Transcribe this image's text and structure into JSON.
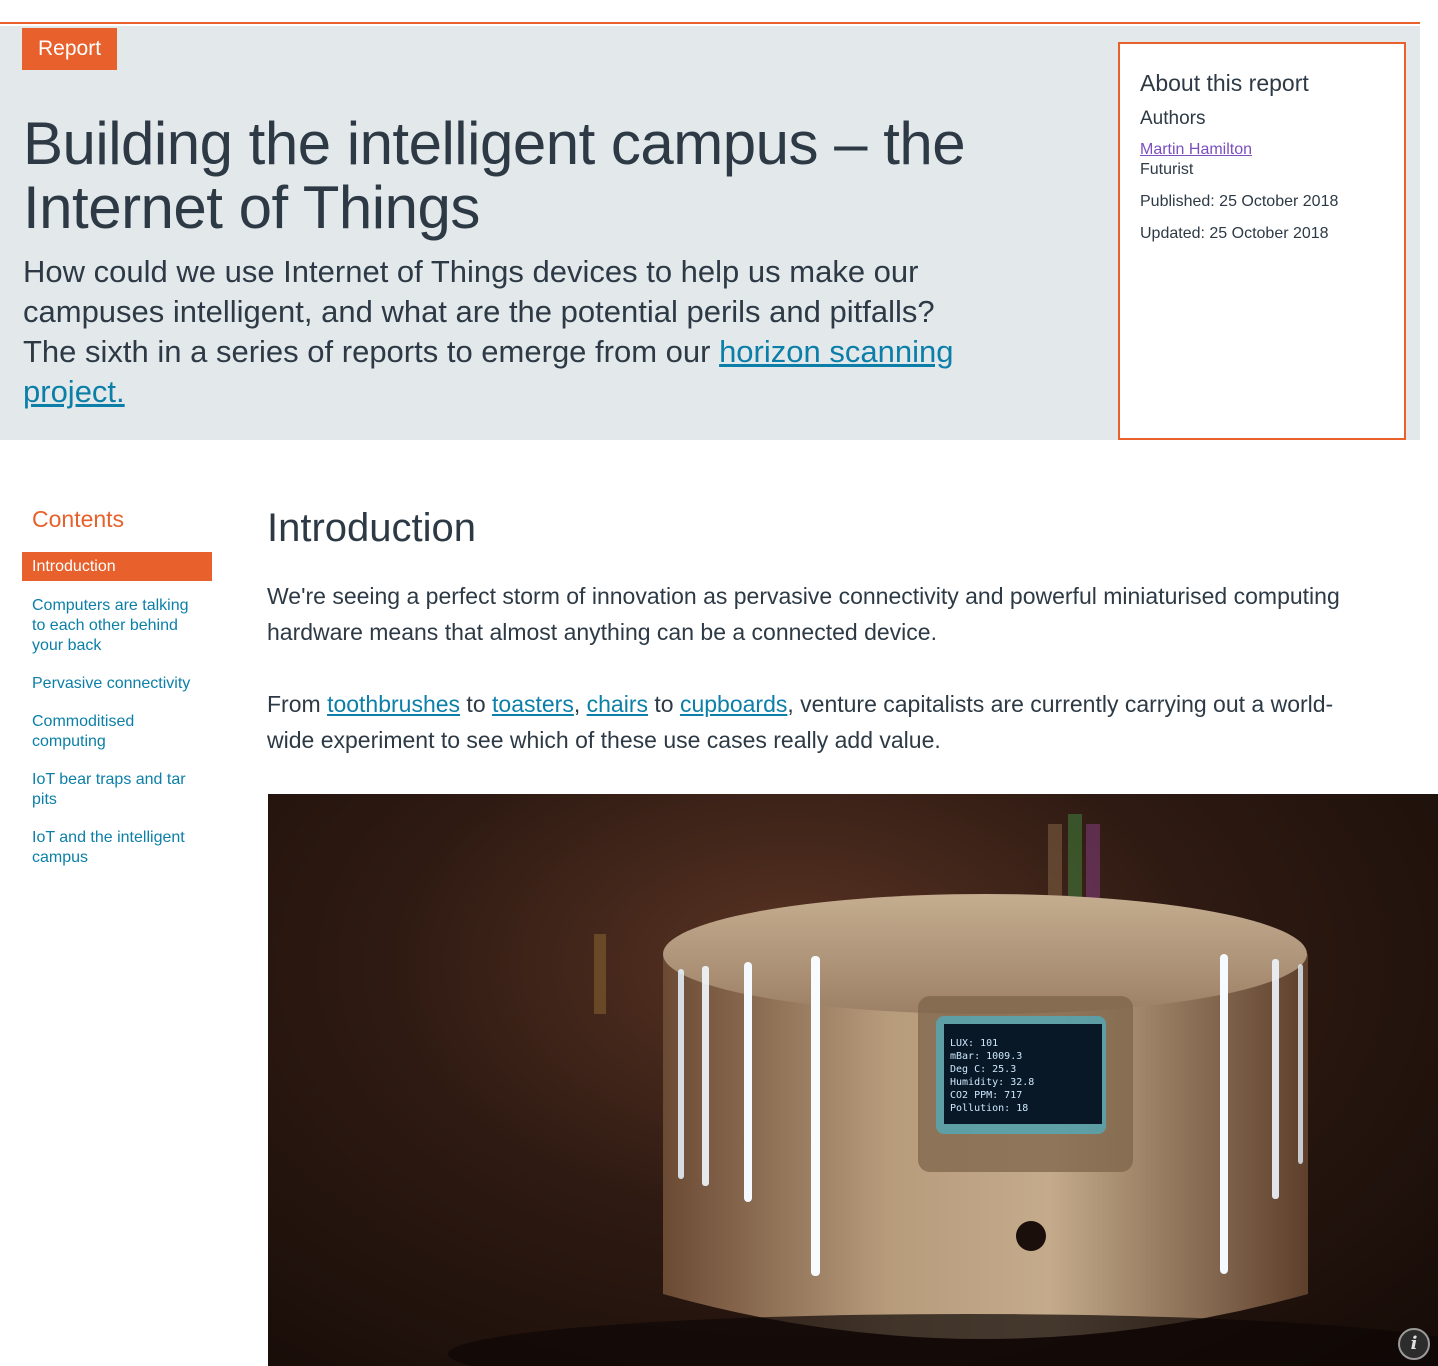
{
  "hero": {
    "badge": "Report",
    "title": "Building the intelligent campus – the Internet of Things",
    "subtitle_text": "How could we use Internet of Things devices to help us make our campuses intelligent, and what are the potential perils and pitfalls? The sixth in a series of reports to emerge from our ",
    "subtitle_link": "horizon scanning project."
  },
  "about": {
    "title": "About this report",
    "authors_label": "Authors",
    "author_name": "Martin Hamilton",
    "author_role": "Futurist",
    "published": "Published: 25 October 2018",
    "updated": "Updated: 25 October 2018"
  },
  "contents": {
    "title": "Contents",
    "items": [
      {
        "label": "Introduction",
        "active": true
      },
      {
        "label": "Computers are talking to each other behind your back",
        "active": false
      },
      {
        "label": "Pervasive connectivity",
        "active": false
      },
      {
        "label": "Commoditised computing",
        "active": false
      },
      {
        "label": "IoT bear traps and tar pits",
        "active": false
      },
      {
        "label": "IoT and the intelligent campus",
        "active": false
      }
    ]
  },
  "article": {
    "heading": "Introduction",
    "p1": "We're seeing a perfect storm of innovation as pervasive connectivity and powerful miniaturised computing hardware means that almost anything can be a connected device.",
    "p2": {
      "from": "From ",
      "link1": "toothbrushes",
      "to1": " to ",
      "link2": "toasters",
      "comma": ", ",
      "link3": "chairs",
      "to2": " to ",
      "link4": "cupboards",
      "rest": ", venture capitalists are currently carrying out a world-wide experiment to see which of these use cases really add value."
    }
  },
  "photo": {
    "screen_lines": [
      "LUX: 101",
      "mBar: 1009.3",
      "Deg C: 25.3",
      "Humidity: 32.8",
      "CO2 PPM: 717",
      "Pollution: 18"
    ],
    "info_glyph": "i"
  },
  "colors": {
    "accent": "#e8612c",
    "link": "#0b7fa8",
    "hero_bg": "#e3e8eb",
    "text": "#2d3a45",
    "visited_link": "#7b4fbf"
  }
}
